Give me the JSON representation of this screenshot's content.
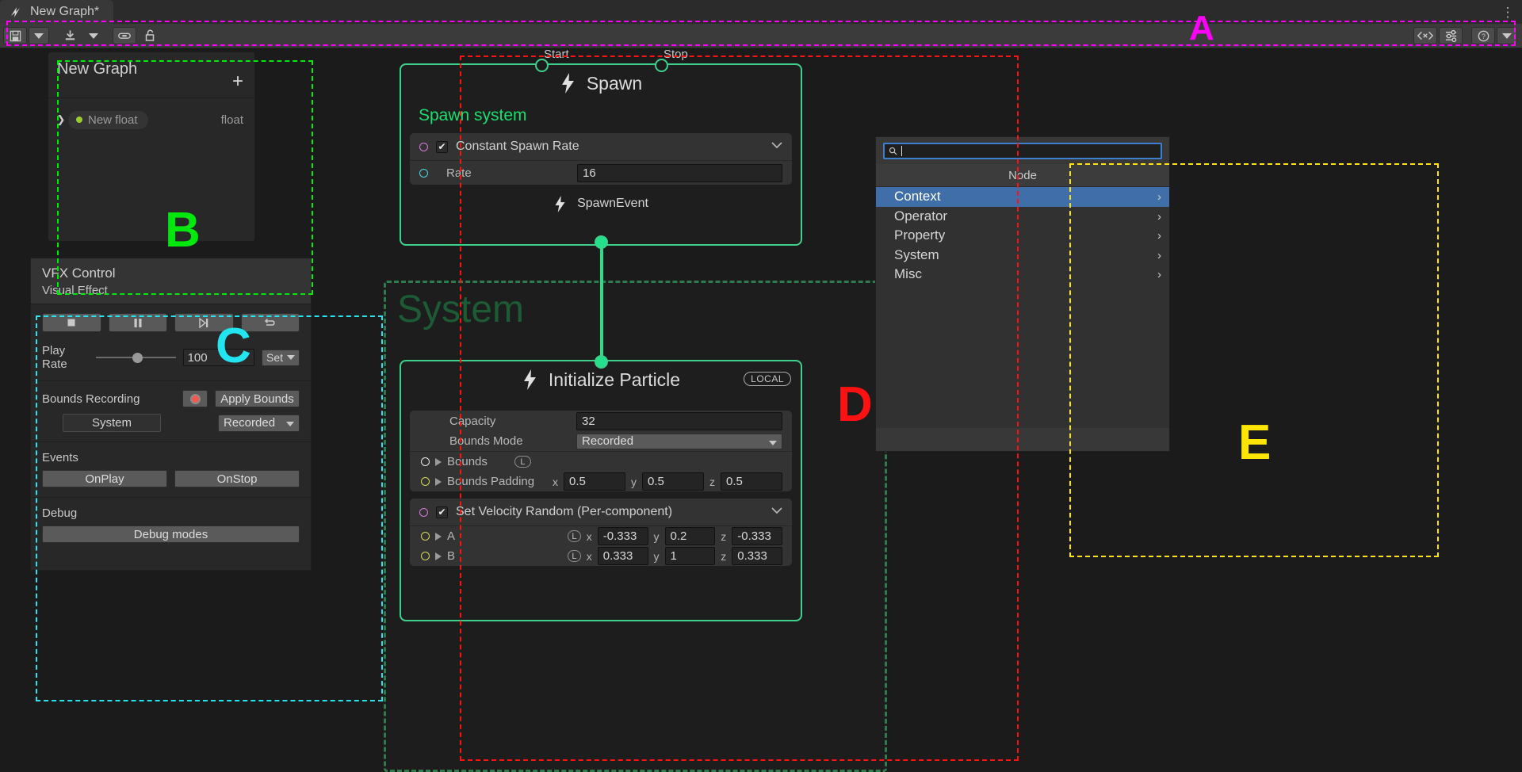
{
  "window": {
    "tab_title": "New Graph*",
    "tab_icon": "vfx-graph-icon",
    "menu_icon": "kebab-menu-icon"
  },
  "toolbar": {
    "save_icon": "save-floppy-icon",
    "save_dropdown_icon": "chevron-down-icon",
    "compile_icon": "compile-download-icon",
    "compile_dropdown_icon": "chevron-down-icon",
    "link_icon": "link-icon",
    "lock_icon": "lock-open-icon",
    "blackboard_icon": "blackboard-angle-brackets-icon",
    "parameters_icon": "sliders-icon",
    "help_icon": "help-question-icon",
    "help_dropdown_icon": "chevron-down-icon"
  },
  "blackboard": {
    "title": "New Graph",
    "add_icon": "plus-icon",
    "expand_icon": "chevron-right-icon",
    "parameter": {
      "name": "New float",
      "type": "float"
    }
  },
  "vfx_control": {
    "title": "VFX Control",
    "subtitle": "Visual Effect",
    "transport": [
      {
        "name": "stop-button",
        "icon": "stop-square-icon"
      },
      {
        "name": "pause-button",
        "icon": "pause-bars-icon"
      },
      {
        "name": "step-button",
        "icon": "step-forward-icon"
      },
      {
        "name": "restart-button",
        "icon": "restart-loop-icon"
      }
    ],
    "play_rate_label": "Play Rate",
    "play_rate_value": "100",
    "play_rate_set": "Set",
    "bounds_recording_label": "Bounds Recording",
    "record_icon": "record-dot-icon",
    "apply_bounds_label": "Apply Bounds",
    "system_label": "System",
    "recorded_label": "Recorded",
    "events_label": "Events",
    "on_play_label": "OnPlay",
    "on_stop_label": "OnStop",
    "debug_label": "Debug",
    "debug_modes_label": "Debug modes"
  },
  "graph": {
    "system_group_label": "System",
    "spawn_node": {
      "title": "Spawn",
      "icon": "lightning-bolt-icon",
      "start_port_label": "Start",
      "stop_port_label": "Stop",
      "subtitle": "Spawn system",
      "block_title": "Constant Spawn Rate",
      "block_checked": "✔",
      "rate_label": "Rate",
      "rate_value": "16",
      "out_label": "SpawnEvent"
    },
    "initialize_node": {
      "title": "Initialize Particle",
      "icon": "lightning-bolt-icon",
      "space_badge": "LOCAL",
      "capacity_label": "Capacity",
      "capacity_value": "32",
      "bounds_mode_label": "Bounds Mode",
      "bounds_mode_value": "Recorded",
      "bounds_label": "Bounds",
      "bounds_space_badge": "L",
      "bounds_padding_label": "Bounds Padding",
      "bounds_padding": {
        "x_label": "x",
        "x": "0.5",
        "y_label": "y",
        "y": "0.5",
        "z_label": "z",
        "z": "0.5"
      },
      "velocity_block_title": "Set Velocity Random (Per-component)",
      "velocity_block_checked": "✔",
      "a_label": "A",
      "a_space_badge": "L",
      "a": {
        "x_label": "x",
        "x": "-0.333",
        "y_label": "y",
        "y": "0.2",
        "z_label": "z",
        "z": "-0.333"
      },
      "b_label": "B",
      "b_space_badge": "L",
      "b": {
        "x_label": "x",
        "x": "0.333",
        "y_label": "y",
        "y": "1",
        "z_label": "z",
        "z": "0.333"
      }
    }
  },
  "node_menu": {
    "search_icon": "search-magnifier-icon",
    "search_value": "",
    "header": "Node",
    "items": [
      {
        "label": "Context",
        "selected": true
      },
      {
        "label": "Operator",
        "selected": false
      },
      {
        "label": "Property",
        "selected": false
      },
      {
        "label": "System",
        "selected": false
      },
      {
        "label": "Misc",
        "selected": false
      }
    ],
    "submenu_arrow": "chevron-right-icon"
  },
  "annotations": [
    {
      "letter": "A",
      "color": "#ff00ff"
    },
    {
      "letter": "B",
      "color": "#00e80e"
    },
    {
      "letter": "C",
      "color": "#23e5ef"
    },
    {
      "letter": "D",
      "color": "#ff1111"
    },
    {
      "letter": "E",
      "color": "#ffe500"
    }
  ]
}
